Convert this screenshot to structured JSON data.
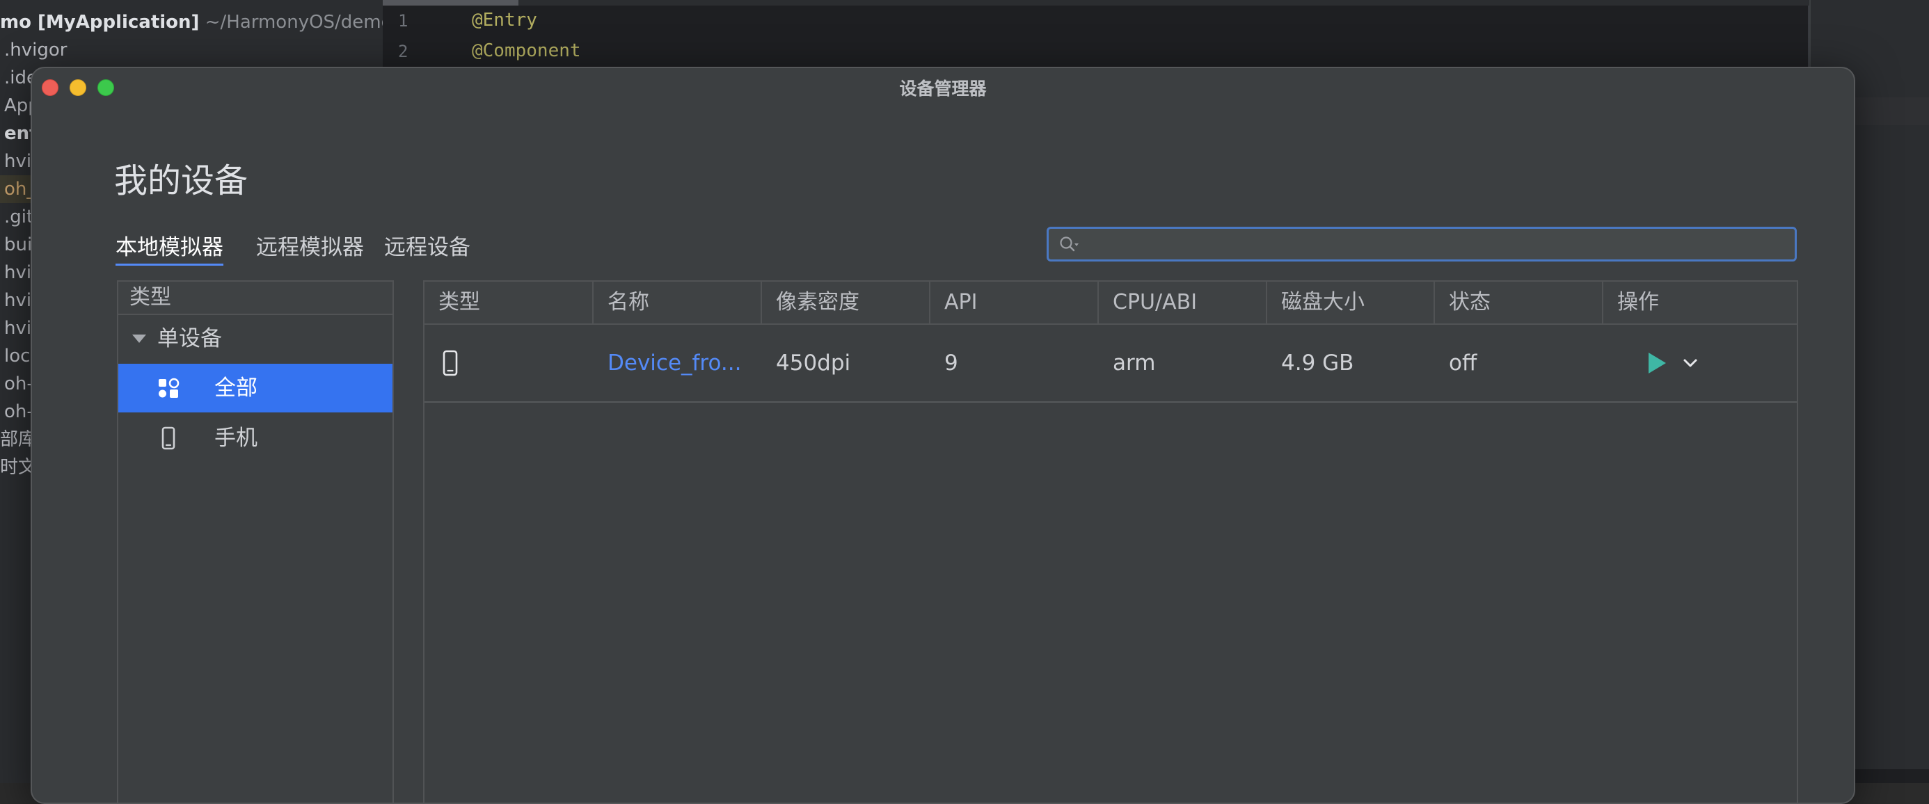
{
  "ide": {
    "project_tree": [
      {
        "prefix": "mo ",
        "bold": "[MyApplication]",
        "suffix": " ~/HarmonyOS/demo"
      },
      {
        "text": ".hvigor"
      },
      {
        "text": ".ide"
      },
      {
        "text": "App"
      },
      {
        "text": "ent",
        "bold": true
      },
      {
        "text": "hvi"
      },
      {
        "text": "oh_",
        "highlight": true
      },
      {
        "text": ".git"
      },
      {
        "text": "bui"
      },
      {
        "text": "hvi"
      },
      {
        "text": "hvi"
      },
      {
        "text": "hvi"
      },
      {
        "text": "loc"
      },
      {
        "text": "oh-"
      },
      {
        "text": "oh-"
      },
      {
        "text": "部库"
      },
      {
        "text": "时文"
      }
    ],
    "editor": {
      "line_numbers": [
        "1",
        "2"
      ],
      "code_lines": [
        "@Entry",
        "@Component"
      ]
    }
  },
  "dialog": {
    "title": "设备管理器",
    "heading": "我的设备",
    "tabs": [
      {
        "label": "本地模拟器",
        "active": true
      },
      {
        "label": "远程模拟器",
        "active": false
      },
      {
        "label": "远程设备",
        "active": false
      }
    ],
    "search": {
      "value": "",
      "placeholder": "",
      "icon": "search-icon"
    },
    "category_panel": {
      "header": "类型",
      "group_label": "单设备",
      "items": [
        {
          "label": "全部",
          "icon": "all-devices-icon",
          "selected": true
        },
        {
          "label": "手机",
          "icon": "phone-icon",
          "selected": false
        }
      ]
    },
    "table": {
      "columns": [
        "类型",
        "名称",
        "像素密度",
        "API",
        "CPU/ABI",
        "磁盘大小",
        "状态",
        "操作"
      ],
      "rows": [
        {
          "type_icon": "phone-icon",
          "name": "Device_fro...",
          "density": "450dpi",
          "api": "9",
          "cpu": "arm",
          "disk": "4.9 GB",
          "status": "off",
          "actions": [
            "play-icon",
            "chevron-down-icon"
          ]
        }
      ]
    },
    "colors": {
      "accent": "#3573f0",
      "link": "#548af7",
      "play": "#3fb7a5",
      "dialog_bg": "#3c3f41"
    }
  }
}
